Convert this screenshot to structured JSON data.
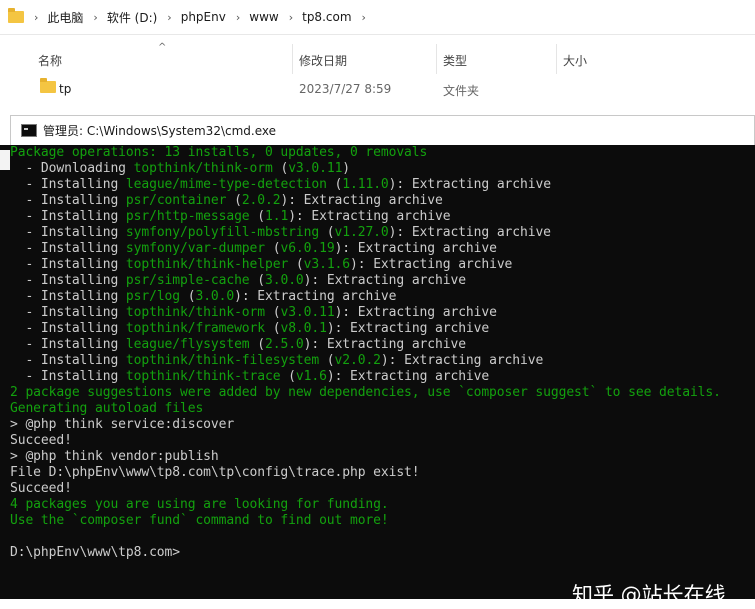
{
  "explorer": {
    "breadcrumb": [
      "此电脑",
      "软件 (D:)",
      "phpEnv",
      "www",
      "tp8.com"
    ],
    "columns": {
      "name": "名称",
      "modified": "修改日期",
      "type": "类型",
      "size": "大小"
    },
    "rows": [
      {
        "name": "tp",
        "modified": "2023/7/27 8:59",
        "type": "文件夹",
        "size": ""
      }
    ]
  },
  "cmd": {
    "title": "管理员: C:\\Windows\\System32\\cmd.exe",
    "prompt": "D:\\phpEnv\\www\\tp8.com>",
    "lines": [
      [
        {
          "t": "Package operations: 13 installs, 0 updates, 0 removals",
          "g": 1
        }
      ],
      [
        {
          "t": "  - Downloading ",
          "g": 0
        },
        {
          "t": "topthink/think-orm",
          "g": 1
        },
        {
          "t": " (",
          "g": 0
        },
        {
          "t": "v3.0.11",
          "g": 1
        },
        {
          "t": ")",
          "g": 0
        }
      ],
      [
        {
          "t": "  - Installing ",
          "g": 0
        },
        {
          "t": "league/mime-type-detection",
          "g": 1
        },
        {
          "t": " (",
          "g": 0
        },
        {
          "t": "1.11.0",
          "g": 1
        },
        {
          "t": "): Extracting archive",
          "g": 0
        }
      ],
      [
        {
          "t": "  - Installing ",
          "g": 0
        },
        {
          "t": "psr/container",
          "g": 1
        },
        {
          "t": " (",
          "g": 0
        },
        {
          "t": "2.0.2",
          "g": 1
        },
        {
          "t": "): Extracting archive",
          "g": 0
        }
      ],
      [
        {
          "t": "  - Installing ",
          "g": 0
        },
        {
          "t": "psr/http-message",
          "g": 1
        },
        {
          "t": " (",
          "g": 0
        },
        {
          "t": "1.1",
          "g": 1
        },
        {
          "t": "): Extracting archive",
          "g": 0
        }
      ],
      [
        {
          "t": "  - Installing ",
          "g": 0
        },
        {
          "t": "symfony/polyfill-mbstring",
          "g": 1
        },
        {
          "t": " (",
          "g": 0
        },
        {
          "t": "v1.27.0",
          "g": 1
        },
        {
          "t": "): Extracting archive",
          "g": 0
        }
      ],
      [
        {
          "t": "  - Installing ",
          "g": 0
        },
        {
          "t": "symfony/var-dumper",
          "g": 1
        },
        {
          "t": " (",
          "g": 0
        },
        {
          "t": "v6.0.19",
          "g": 1
        },
        {
          "t": "): Extracting archive",
          "g": 0
        }
      ],
      [
        {
          "t": "  - Installing ",
          "g": 0
        },
        {
          "t": "topthink/think-helper",
          "g": 1
        },
        {
          "t": " (",
          "g": 0
        },
        {
          "t": "v3.1.6",
          "g": 1
        },
        {
          "t": "): Extracting archive",
          "g": 0
        }
      ],
      [
        {
          "t": "  - Installing ",
          "g": 0
        },
        {
          "t": "psr/simple-cache",
          "g": 1
        },
        {
          "t": " (",
          "g": 0
        },
        {
          "t": "3.0.0",
          "g": 1
        },
        {
          "t": "): Extracting archive",
          "g": 0
        }
      ],
      [
        {
          "t": "  - Installing ",
          "g": 0
        },
        {
          "t": "psr/log",
          "g": 1
        },
        {
          "t": " (",
          "g": 0
        },
        {
          "t": "3.0.0",
          "g": 1
        },
        {
          "t": "): Extracting archive",
          "g": 0
        }
      ],
      [
        {
          "t": "  - Installing ",
          "g": 0
        },
        {
          "t": "topthink/think-orm",
          "g": 1
        },
        {
          "t": " (",
          "g": 0
        },
        {
          "t": "v3.0.11",
          "g": 1
        },
        {
          "t": "): Extracting archive",
          "g": 0
        }
      ],
      [
        {
          "t": "  - Installing ",
          "g": 0
        },
        {
          "t": "topthink/framework",
          "g": 1
        },
        {
          "t": " (",
          "g": 0
        },
        {
          "t": "v8.0.1",
          "g": 1
        },
        {
          "t": "): Extracting archive",
          "g": 0
        }
      ],
      [
        {
          "t": "  - Installing ",
          "g": 0
        },
        {
          "t": "league/flysystem",
          "g": 1
        },
        {
          "t": " (",
          "g": 0
        },
        {
          "t": "2.5.0",
          "g": 1
        },
        {
          "t": "): Extracting archive",
          "g": 0
        }
      ],
      [
        {
          "t": "  - Installing ",
          "g": 0
        },
        {
          "t": "topthink/think-filesystem",
          "g": 1
        },
        {
          "t": " (",
          "g": 0
        },
        {
          "t": "v2.0.2",
          "g": 1
        },
        {
          "t": "): Extracting archive",
          "g": 0
        }
      ],
      [
        {
          "t": "  - Installing ",
          "g": 0
        },
        {
          "t": "topthink/think-trace",
          "g": 1
        },
        {
          "t": " (",
          "g": 0
        },
        {
          "t": "v1.6",
          "g": 1
        },
        {
          "t": "): Extracting archive",
          "g": 0
        }
      ],
      [
        {
          "t": "2 package suggestions were added by new dependencies, use `composer suggest` to see details.",
          "g": 1
        }
      ],
      [
        {
          "t": "Generating autoload files",
          "g": 1
        }
      ],
      [
        {
          "t": "> @php think service:discover",
          "g": 0
        }
      ],
      [
        {
          "t": "Succeed!",
          "g": 0
        }
      ],
      [
        {
          "t": "> @php think vendor:publish",
          "g": 0
        }
      ],
      [
        {
          "t": "File D:\\phpEnv\\www\\tp8.com\\tp\\config\\trace.php exist!",
          "g": 0
        }
      ],
      [
        {
          "t": "Succeed!",
          "g": 0
        }
      ],
      [
        {
          "t": "4 packages you are using are looking for funding.",
          "g": 1
        }
      ],
      [
        {
          "t": "Use the `composer fund` command to find out more!",
          "g": 1
        }
      ],
      [
        {
          "t": "",
          "g": 0
        }
      ]
    ]
  },
  "watermark": "知乎 @站长在线",
  "colors": {
    "terminal_bg": "#0c0c0c",
    "terminal_text": "#cccccc",
    "terminal_green": "#13a10e"
  }
}
